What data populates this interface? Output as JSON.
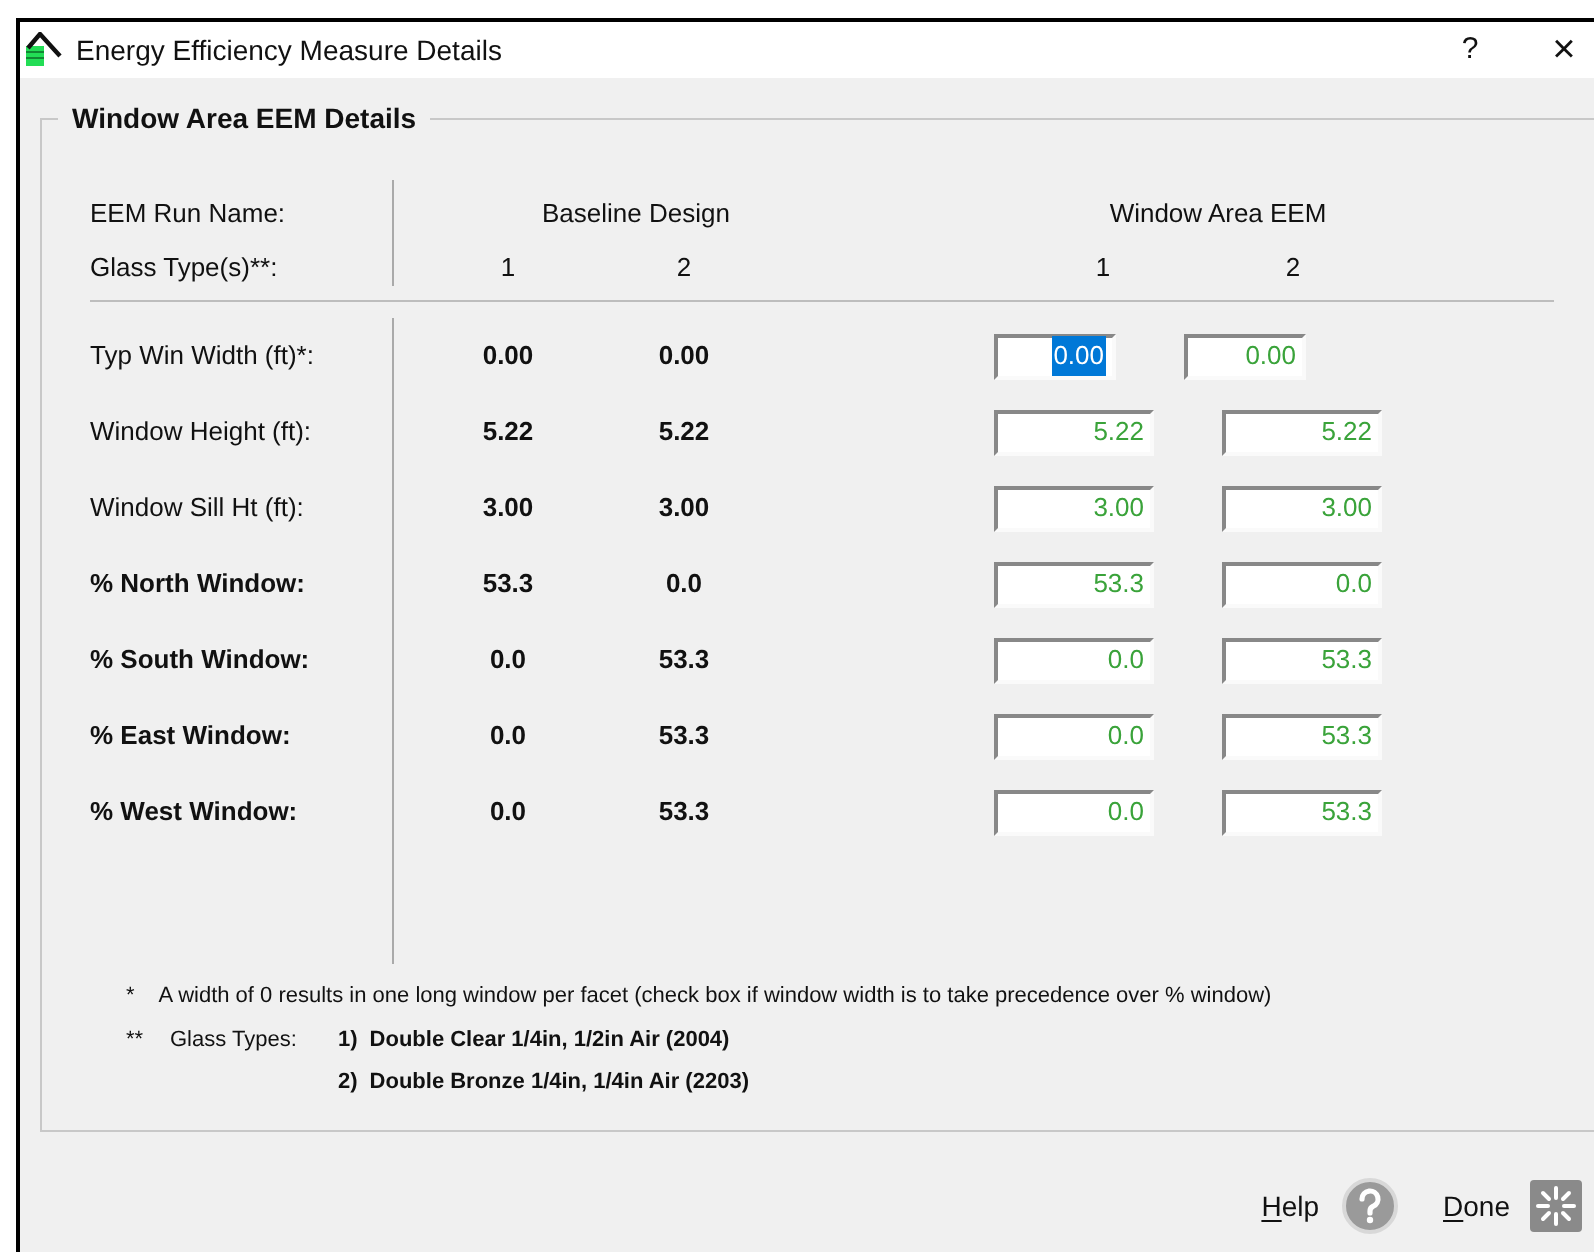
{
  "window": {
    "title": "Energy Efficiency Measure Details",
    "title_buttons": [
      "?",
      "×"
    ]
  },
  "group": {
    "title": "Window Area EEM Details",
    "header": {
      "run_name_label": "EEM Run Name:",
      "glass_label": "Glass Type(s)**:",
      "baseline_title": "Baseline Design",
      "baseline_columns": [
        "1",
        "2"
      ],
      "eem_title": "Window Area EEM",
      "eem_columns": [
        "1",
        "2"
      ]
    },
    "rows": [
      {
        "label": "Typ Win Width (ft)*:",
        "bold": false,
        "kind": "short",
        "baseline": [
          "0.00",
          "0.00"
        ],
        "eem": [
          {
            "value": "0.00",
            "selected": true
          },
          {
            "value": "0.00",
            "selected": false
          }
        ]
      },
      {
        "label": "Window Height (ft):",
        "bold": false,
        "kind": "long",
        "baseline": [
          "5.22",
          "5.22"
        ],
        "eem": [
          {
            "value": "5.22",
            "selected": false
          },
          {
            "value": "5.22",
            "selected": false
          }
        ]
      },
      {
        "label": "Window Sill Ht (ft):",
        "bold": false,
        "kind": "long",
        "baseline": [
          "3.00",
          "3.00"
        ],
        "eem": [
          {
            "value": "3.00",
            "selected": false
          },
          {
            "value": "3.00",
            "selected": false
          }
        ]
      },
      {
        "label": "% North Window:",
        "bold": true,
        "kind": "long",
        "baseline": [
          "53.3",
          "0.0"
        ],
        "eem": [
          {
            "value": "53.3",
            "selected": false
          },
          {
            "value": "0.0",
            "selected": false
          }
        ]
      },
      {
        "label": "% South Window:",
        "bold": true,
        "kind": "long",
        "baseline": [
          "0.0",
          "53.3"
        ],
        "eem": [
          {
            "value": "0.0",
            "selected": false
          },
          {
            "value": "53.3",
            "selected": false
          }
        ]
      },
      {
        "label": "% East Window:",
        "bold": true,
        "kind": "long",
        "baseline": [
          "0.0",
          "53.3"
        ],
        "eem": [
          {
            "value": "0.0",
            "selected": false
          },
          {
            "value": "53.3",
            "selected": false
          }
        ]
      },
      {
        "label": "% West Window:",
        "bold": true,
        "kind": "long",
        "baseline": [
          "0.0",
          "53.3"
        ],
        "eem": [
          {
            "value": "0.0",
            "selected": false
          },
          {
            "value": "53.3",
            "selected": false
          }
        ]
      }
    ],
    "footnote": {
      "mark": "*",
      "text": "A width of 0 results in one long window per facet (check box if window width is to take precedence over % window)"
    },
    "glass_types": {
      "mark": "**",
      "label": "Glass Types:",
      "items": [
        {
          "number": "1)",
          "name": "Double Clear 1/4in, 1/2in Air (2004)"
        },
        {
          "number": "2)",
          "name": "Double Bronze 1/4in, 1/4in Air (2203)"
        }
      ]
    }
  },
  "buttons": [
    {
      "label": "Help",
      "kind": "help"
    },
    {
      "label": "Done",
      "kind": "done"
    }
  ]
}
